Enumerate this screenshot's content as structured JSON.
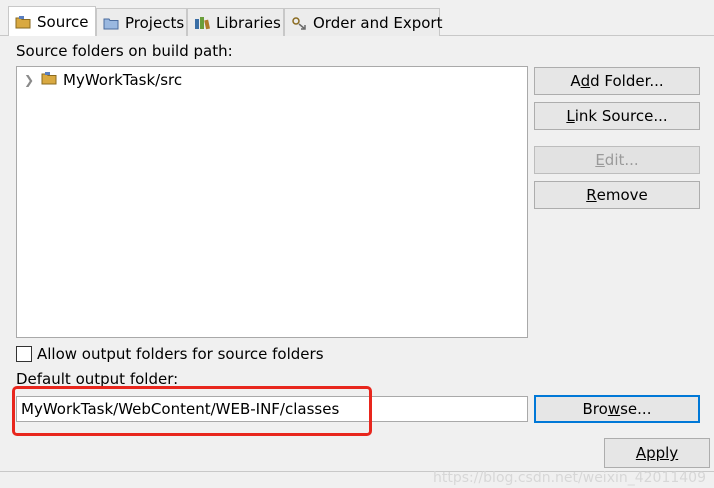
{
  "tabs": [
    {
      "label": "Source",
      "icon": "source-icon",
      "active": true
    },
    {
      "label": "Projects",
      "icon": "projects-icon",
      "active": false
    },
    {
      "label": "Libraries",
      "icon": "libraries-icon",
      "active": false
    },
    {
      "label": "Order and Export",
      "icon": "order-export-icon",
      "active": false
    }
  ],
  "source": {
    "heading": "Source folders on build path:",
    "tree": [
      {
        "label": "MyWorkTask/src",
        "icon": "package-folder-icon",
        "expanded": false
      }
    ],
    "buttons": {
      "add_folder": {
        "pre": "A",
        "mn": "d",
        "post": "d Folder..."
      },
      "link_source": {
        "pre": "",
        "mn": "L",
        "post": "ink Source..."
      },
      "edit": {
        "pre": "",
        "mn": "E",
        "post": "dit..."
      },
      "remove": {
        "pre": "",
        "mn": "R",
        "post": "emove"
      }
    },
    "allow_output_label": "Allow output folders for source folders",
    "default_output_label": "Default output folder:",
    "output_value": "MyWorkTask/WebContent/WEB-INF/classes",
    "browse": {
      "pre": "Bro",
      "mn": "w",
      "post": "se..."
    }
  },
  "apply_label": "Apply",
  "watermark": "https://blog.csdn.net/weixin_42011409",
  "colors": {
    "highlight": "#e8261d",
    "focus": "#0078d7"
  }
}
